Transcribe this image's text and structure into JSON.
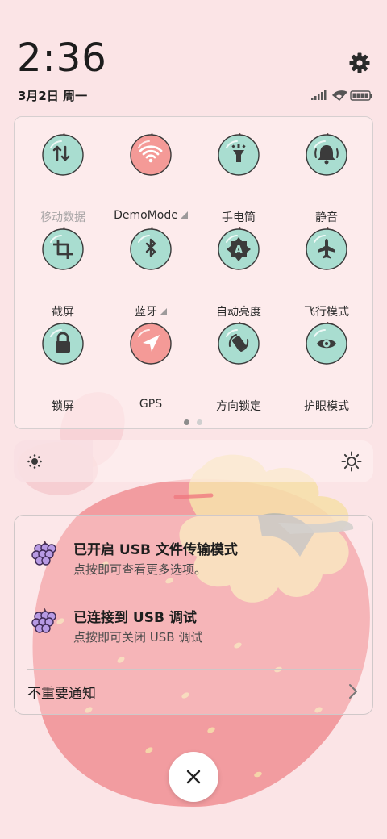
{
  "status": {
    "time": "2:36",
    "date": "3月2日 周一",
    "icons": [
      "signal-icon",
      "wifi-icon",
      "battery-icon"
    ]
  },
  "quick_settings": {
    "tiles": [
      {
        "label": "移动数据",
        "icon": "mobile-data-icon",
        "active": false,
        "disabled": true,
        "expandable": false
      },
      {
        "label": "DemoMode",
        "icon": "wifi-icon",
        "active": true,
        "disabled": false,
        "expandable": true
      },
      {
        "label": "手电筒",
        "icon": "flashlight-icon",
        "active": false,
        "disabled": false,
        "expandable": false
      },
      {
        "label": "静音",
        "icon": "bell-icon",
        "active": false,
        "disabled": false,
        "expandable": false
      },
      {
        "label": "截屏",
        "icon": "crop-icon",
        "active": false,
        "disabled": false,
        "expandable": false
      },
      {
        "label": "蓝牙",
        "icon": "bluetooth-icon",
        "active": false,
        "disabled": false,
        "expandable": true
      },
      {
        "label": "自动亮度",
        "icon": "auto-brightness-icon",
        "active": false,
        "disabled": false,
        "expandable": false
      },
      {
        "label": "飞行模式",
        "icon": "airplane-icon",
        "active": false,
        "disabled": false,
        "expandable": false
      },
      {
        "label": "锁屏",
        "icon": "lock-icon",
        "active": false,
        "disabled": false,
        "expandable": false
      },
      {
        "label": "GPS",
        "icon": "location-icon",
        "active": true,
        "disabled": false,
        "expandable": false
      },
      {
        "label": "方向锁定",
        "icon": "rotation-lock-icon",
        "active": false,
        "disabled": false,
        "expandable": false
      },
      {
        "label": "护眼模式",
        "icon": "eye-icon",
        "active": false,
        "disabled": false,
        "expandable": false
      }
    ],
    "pages": 2,
    "current_page": 1
  },
  "brightness": {
    "level": 0.22
  },
  "notifications": [
    {
      "title": "已开启 USB 文件传输模式",
      "subtitle": "点按即可查看更多选项。",
      "icon": "grape-icon"
    },
    {
      "title": "已连接到 USB 调试",
      "subtitle": "点按即可关闭 USB 调试",
      "icon": "grape-icon"
    }
  ],
  "less_important": {
    "label": "不重要通知"
  },
  "colors": {
    "background": "#fbe4e6",
    "tile_inactive": "#a9ddd0",
    "tile_active": "#f49a97",
    "dot_active": "#8c8c8c",
    "dot_inactive": "#cfcfcf"
  }
}
